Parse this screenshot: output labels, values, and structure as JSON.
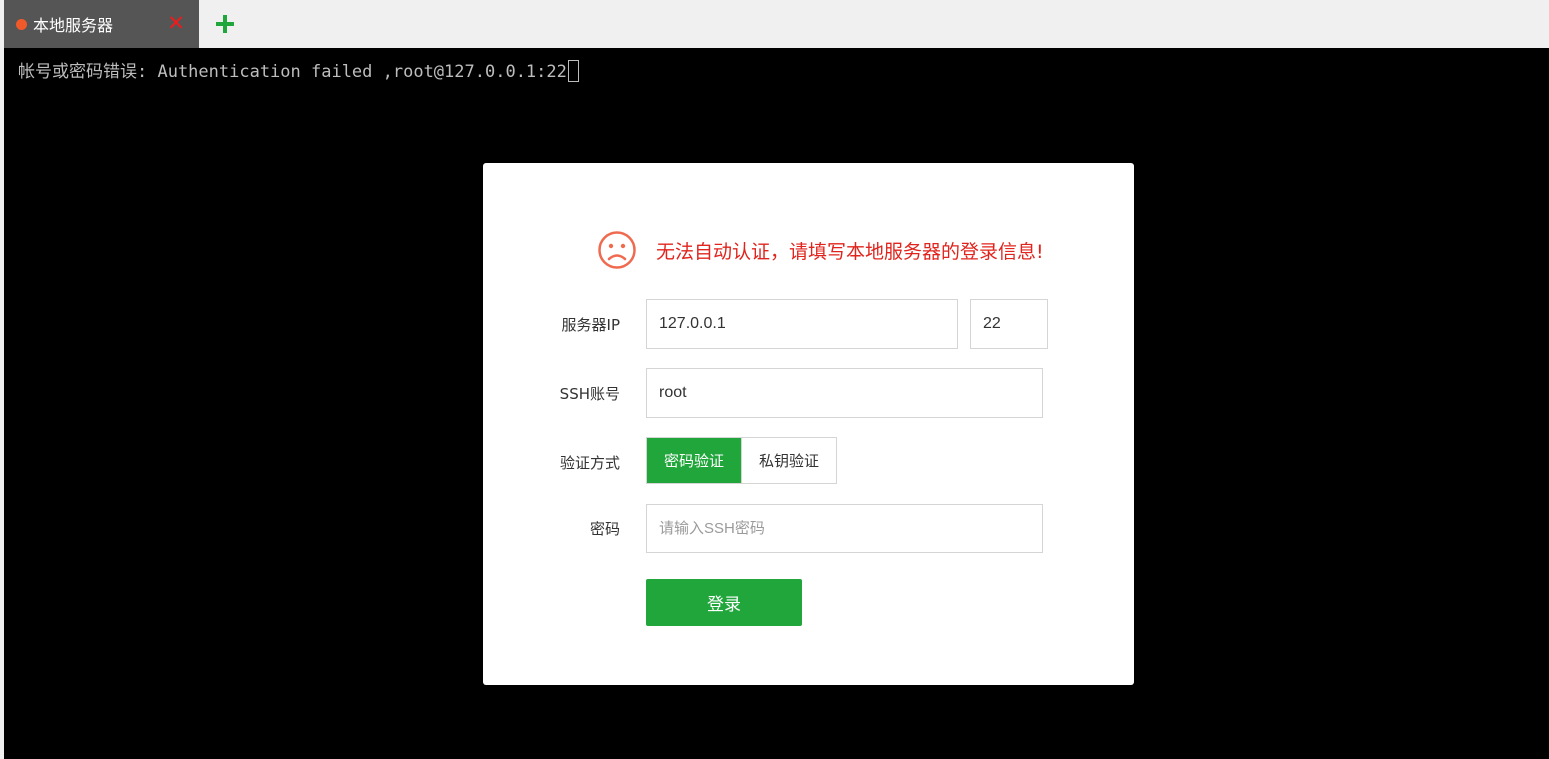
{
  "tabs": [
    {
      "label": "本地服务器",
      "status_color": "#f0592a"
    }
  ],
  "tab_actions": {
    "close_icon": "close-icon",
    "add_icon": "plus-icon"
  },
  "terminal": {
    "line": "帐号或密码错误: Authentication failed ,root@127.0.0.1:22"
  },
  "dialog": {
    "message": "无法自动认证，请填写本地服务器的登录信息!",
    "message_icon": "sad-face-icon",
    "server_ip_label": "服务器IP",
    "server_ip_value": "127.0.0.1",
    "port_value": "22",
    "ssh_account_label": "SSH账号",
    "ssh_account_value": "root",
    "auth_method_label": "验证方式",
    "auth_methods": [
      {
        "label": "密码验证",
        "selected": true
      },
      {
        "label": "私钥验证",
        "selected": false
      }
    ],
    "password_label": "密码",
    "password_placeholder": "请输入SSH密码",
    "login_button": "登录"
  },
  "colors": {
    "accent": "#21a63b",
    "error": "#e0241d",
    "terminal_bg": "#000000",
    "tab_active_bg": "#555555"
  }
}
